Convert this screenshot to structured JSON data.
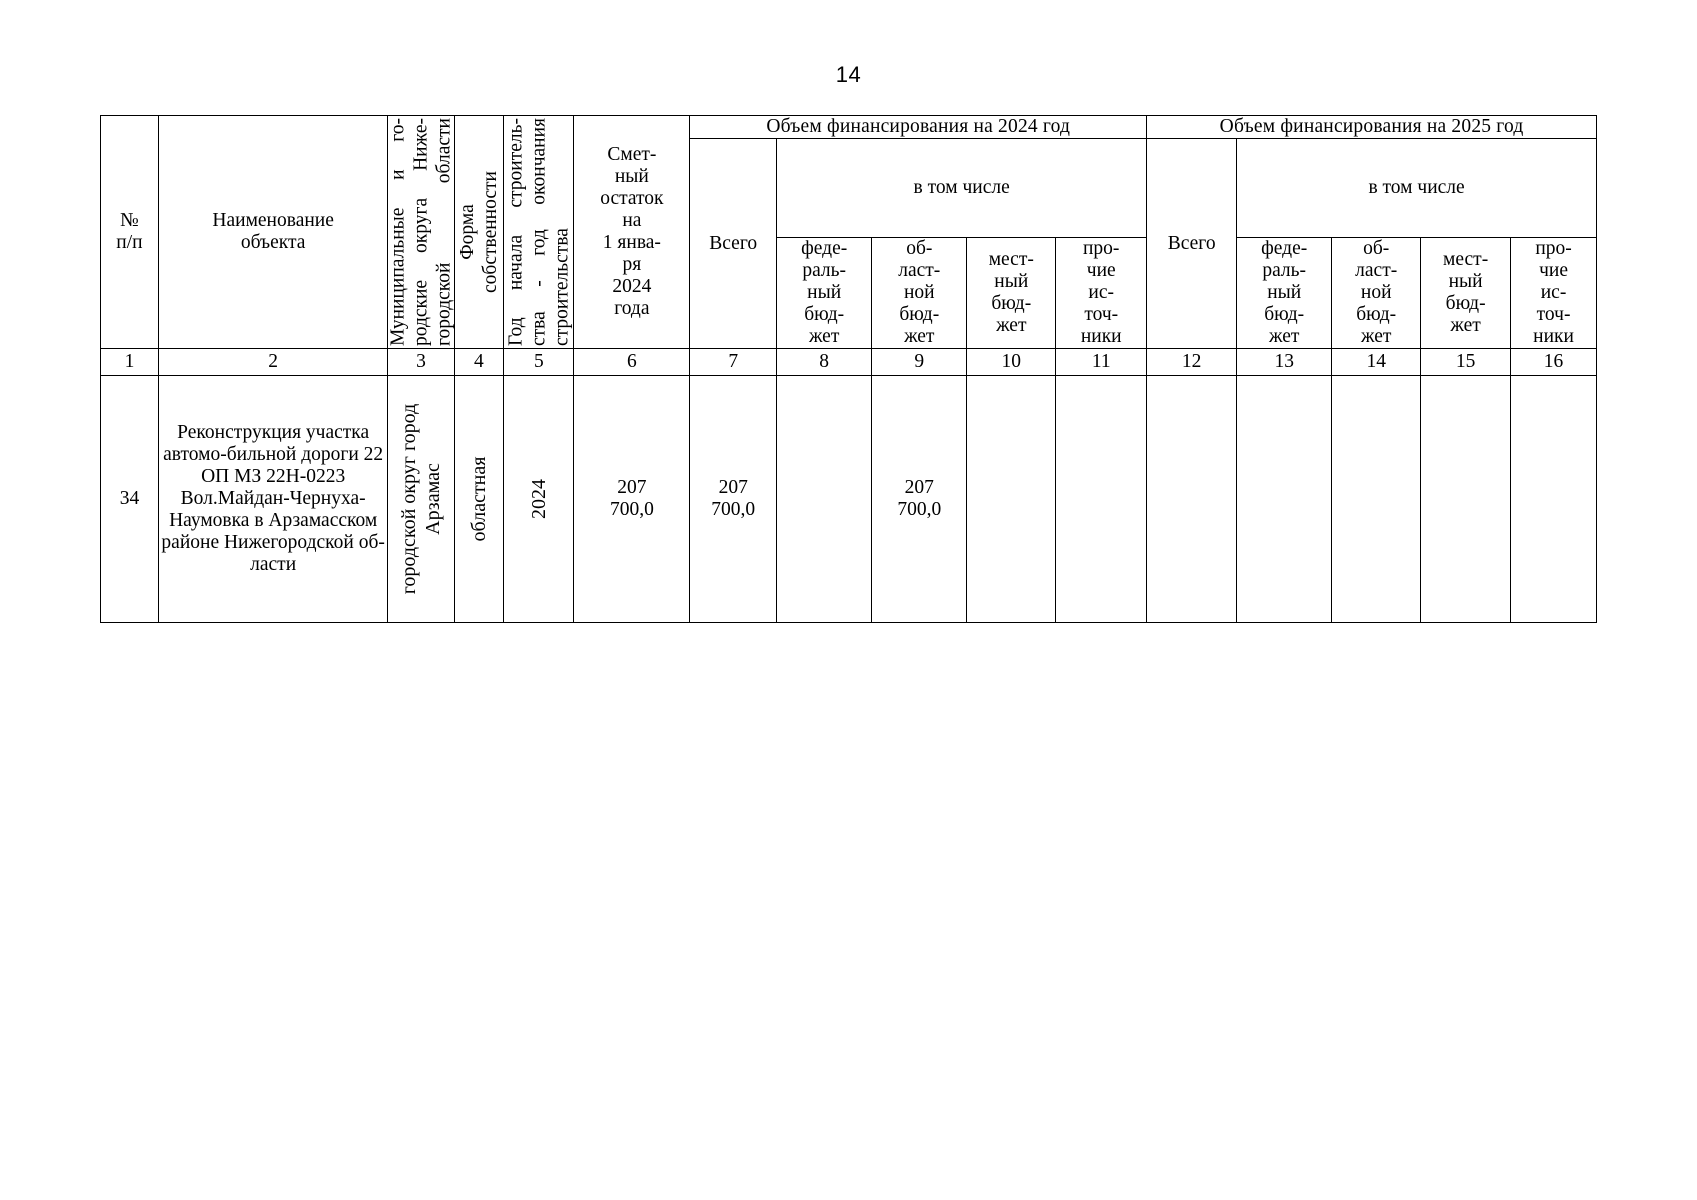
{
  "page": {
    "number": "14"
  },
  "table": {
    "headers": {
      "col_no": "№\nп/п",
      "col_name": "Наименование\nобъекта",
      "col_municipal": "Муниципальные  и го-\nродские округа Ниже-\nгородской области",
      "col_ownership": "Форма\nсобственности",
      "col_years": "Год начала строитель-\nства - год окончания\nстроительства",
      "col_estimate": "Смет-\nный\nостаток\nна\n1 янва-\nря\n2024\nгода",
      "group_2024": "Объем финансирования на 2024 год",
      "group_2025": "Объем финансирования на 2025 год",
      "in_that_number": "в том числе",
      "total": "Всего",
      "federal": "феде-\nраль-\nный\nбюд-\nжет",
      "regional": "об-\nласт-\nной\nбюд-\nжет",
      "local": "мест-\nный\nбюд-\nжет",
      "other": "про-\nчие\nис-\nточ-\nники"
    },
    "column_numbers": [
      "1",
      "2",
      "3",
      "4",
      "5",
      "6",
      "7",
      "8",
      "9",
      "10",
      "11",
      "12",
      "13",
      "14",
      "15",
      "16"
    ],
    "rows": [
      {
        "no": "34",
        "name": "Реконструкция участка автомо-бильной дороги 22 ОП МЗ 22Н-0223 Вол.Майдан-Чернуха-Наумовка в Арзамасском районе Нижегородской об-ласти",
        "municipal": "городской округ город Арзамас",
        "ownership": "областная",
        "years": "2024",
        "estimate_remainder": "207\n700,0",
        "y2024_total": "207\n700,0",
        "y2024_federal": "",
        "y2024_regional": "207\n700,0",
        "y2024_local": "",
        "y2024_other": "",
        "y2025_total": "",
        "y2025_federal": "",
        "y2025_regional": "",
        "y2025_local": "",
        "y2025_other": ""
      }
    ]
  }
}
